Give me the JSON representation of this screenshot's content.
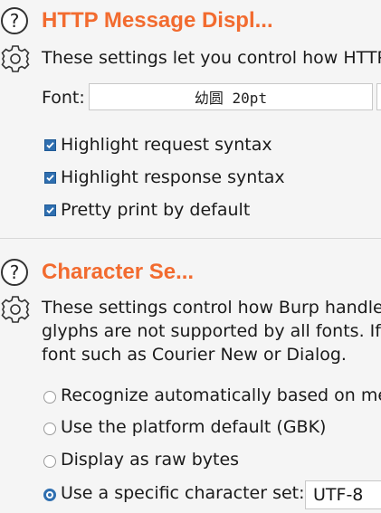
{
  "http_section": {
    "title": "HTTP Message Displ...",
    "description": "These settings let you control how HTTP",
    "font_label": "Font:",
    "font_value": "幼圆 20pt",
    "options": [
      {
        "label": "Highlight request syntax",
        "checked": true
      },
      {
        "label": "Highlight response syntax",
        "checked": true
      },
      {
        "label": "Pretty print by default",
        "checked": true
      }
    ]
  },
  "charset_section": {
    "title": "Character Se...",
    "description_lines": [
      "These settings control how Burp handle",
      "glyphs are not supported by all fonts. If",
      "font such as Courier New or Dialog."
    ],
    "options": [
      {
        "label": "Recognize automatically based on me",
        "selected": false
      },
      {
        "label": "Use the platform default (GBK)",
        "selected": false
      },
      {
        "label": "Display as raw bytes",
        "selected": false
      },
      {
        "label": "Use a specific character set:",
        "selected": true
      }
    ],
    "charset_value": "UTF-8"
  },
  "colors": {
    "accent_title": "#f26b2f",
    "control_blue": "#2f6fb0"
  },
  "icons": [
    "help-icon",
    "gear-icon",
    "checkmark-icon"
  ]
}
